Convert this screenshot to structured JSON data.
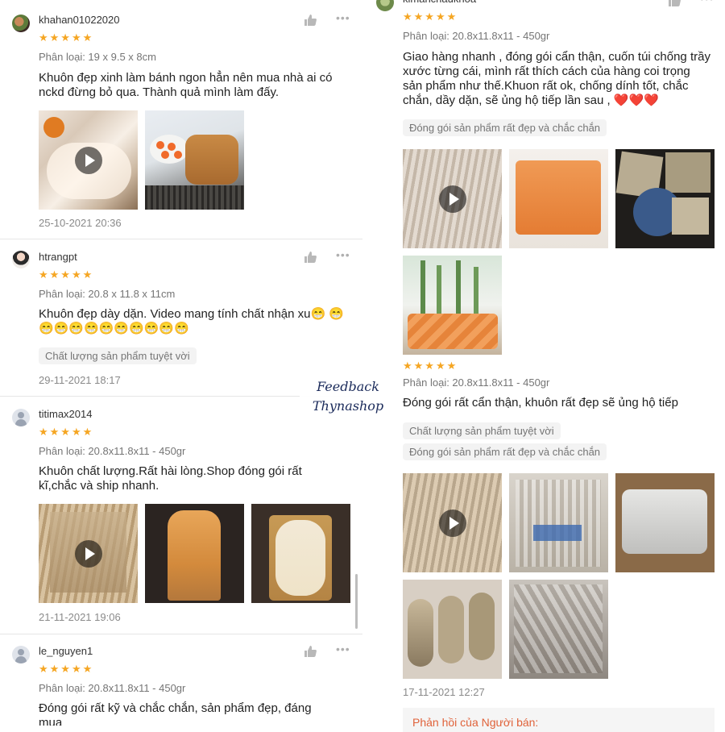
{
  "watermark": {
    "line1": "Feedback",
    "line2": "Thynashop"
  },
  "left_reviews": [
    {
      "username": "khahan01022020",
      "stars": "★★★★★",
      "variant": "Phân loại: 19 x 9.5 x 8cm",
      "text": "Khuôn đẹp xinh làm bánh ngon hẳn nên mua nhà ai có nckd đừng bỏ qua. Thành quả mình làm đấy.",
      "date": "25-10-2021 20:36"
    },
    {
      "username": "htrangpt",
      "stars": "★★★★★",
      "variant": "Phân loại: 20.8 x 11.8 x 11cm",
      "text": "Khuôn đẹp dày dặn. Video mang tính chất nhận xu😁 😁😁😁😁😁😁😁😁😁😁😁",
      "chip": "Chất lượng sản phẩm tuyệt vời",
      "date": "29-11-2021 18:17"
    },
    {
      "username": "titimax2014",
      "stars": "★★★★★",
      "variant": "Phân loại: 20.8x11.8x11 - 450gr",
      "text": "Khuôn chất lượng.Rất hài lòng.Shop đóng gói rất kĩ,chắc và ship nhanh.",
      "date": "21-11-2021 19:06"
    },
    {
      "username": "le_nguyen1",
      "stars": "★★★★★",
      "variant": "Phân loại: 20.8x11.8x11 - 450gr",
      "text": "Đóng gói rất kỹ và chắc chắn, sản phẩm đẹp, đáng mua"
    }
  ],
  "right_reviews": [
    {
      "username": "kimanchaukhoa",
      "stars": "★★★★★",
      "variant": "Phân loại: 20.8x11.8x11 - 450gr",
      "text": "Giao hàng nhanh , đóng gói cẩn thận, cuốn túi chống trầy xước từng cái, mình rất thích cách của hàng coi trọng sản phẩm như thế.Khuon rất ok, chống dính tốt, chắc chắn, dầy dặn, sẽ ủng hộ tiếp lần sau , ❤️❤️❤️",
      "chip": "Đóng gói sản phẩm rất đẹp và chắc chắn"
    },
    {
      "stars": "★★★★★",
      "variant": "Phân loại: 20.8x11.8x11 - 450gr",
      "text": "Đóng gói rất cẩn thận, khuôn rất đẹp sẽ ủng hộ tiếp",
      "chip1": "Chất lượng sản phẩm tuyệt vời",
      "chip2": "Đóng gói sản phẩm rất đẹp và chắc chắn",
      "date": "17-11-2021 12:27"
    }
  ],
  "seller_reply": {
    "label": "Phản hồi của Người bán:"
  },
  "icons": {
    "like": "thumbs-up-icon",
    "more": "more-dots-icon",
    "play": "play-icon"
  }
}
